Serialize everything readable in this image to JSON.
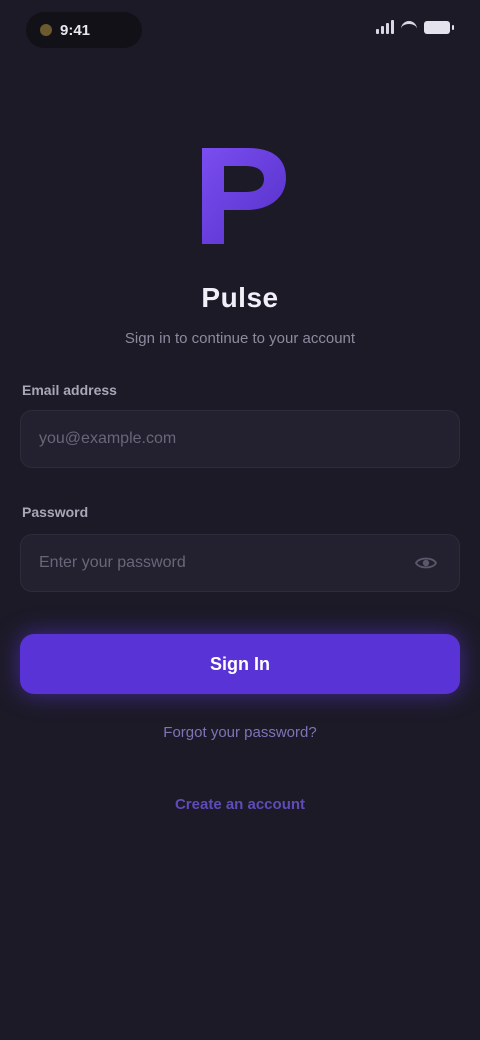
{
  "status_bar": {
    "time": "9:41",
    "icons": [
      "signal-icon",
      "wifi-icon",
      "battery-icon"
    ]
  },
  "app": {
    "title": "Pulse",
    "subtitle": "Sign in to continue to your account",
    "logo_icon": "p-logo-icon",
    "accent_color": "#5a33d6"
  },
  "form": {
    "email_label": "Email address",
    "email_placeholder": "you@example.com",
    "email_value": "",
    "password_label": "Password",
    "password_placeholder": "Enter your password",
    "password_value": "",
    "password_toggle_icon": "eye-icon"
  },
  "actions": {
    "signin_label": "Sign In",
    "forgot_label": "Forgot your password?",
    "create_label": "Create an account"
  }
}
